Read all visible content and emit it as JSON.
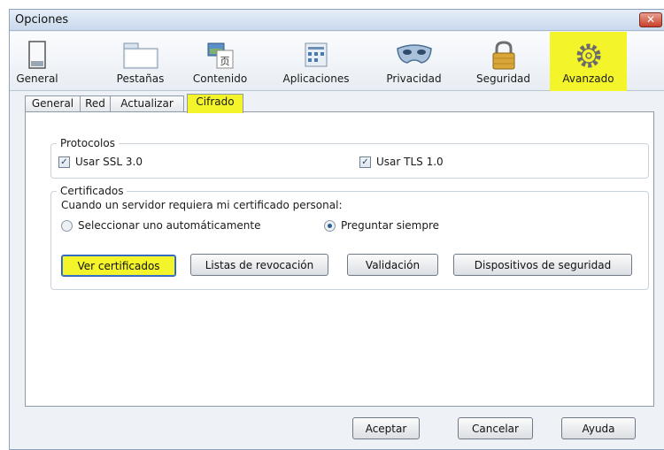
{
  "window": {
    "title": "Opciones",
    "close_glyph": "✕"
  },
  "toolbar": {
    "panes": [
      {
        "label": "General",
        "icon": "window-icon"
      },
      {
        "label": "Pestañas",
        "icon": "tabs-icon"
      },
      {
        "label": "Contenido",
        "icon": "content-icon"
      },
      {
        "label": "Aplicaciones",
        "icon": "applications-icon"
      },
      {
        "label": "Privacidad",
        "icon": "mask-icon"
      },
      {
        "label": "Seguridad",
        "icon": "padlock-icon"
      },
      {
        "label": "Avanzado",
        "icon": "gear-icon",
        "selected": true
      }
    ]
  },
  "tabs": [
    {
      "label": "General"
    },
    {
      "label": "Red"
    },
    {
      "label": "Actualizar"
    },
    {
      "label": "Cifrado",
      "active": true
    }
  ],
  "protocols": {
    "legend": "Protocolos",
    "ssl": {
      "label": "Usar SSL 3.0",
      "checked": true
    },
    "tls": {
      "label": "Usar TLS 1.0",
      "checked": true
    }
  },
  "certificates": {
    "legend": "Certificados",
    "prompt": "Cuando un servidor requiera mi certificado personal:",
    "option_auto": {
      "label": "Seleccionar uno automáticamente",
      "selected": false
    },
    "option_ask": {
      "label": "Preguntar siempre",
      "selected": true
    },
    "buttons": {
      "view": "Ver certificados",
      "revocation": "Listas de revocación",
      "validation": "Validación",
      "devices": "Dispositivos de seguridad"
    }
  },
  "footer": {
    "accept": "Aceptar",
    "cancel": "Cancelar",
    "help": "Ayuda"
  },
  "colors": {
    "highlight": "#f4f42a",
    "window_bg": "#eef1f5",
    "border": "#8e9aa8"
  }
}
